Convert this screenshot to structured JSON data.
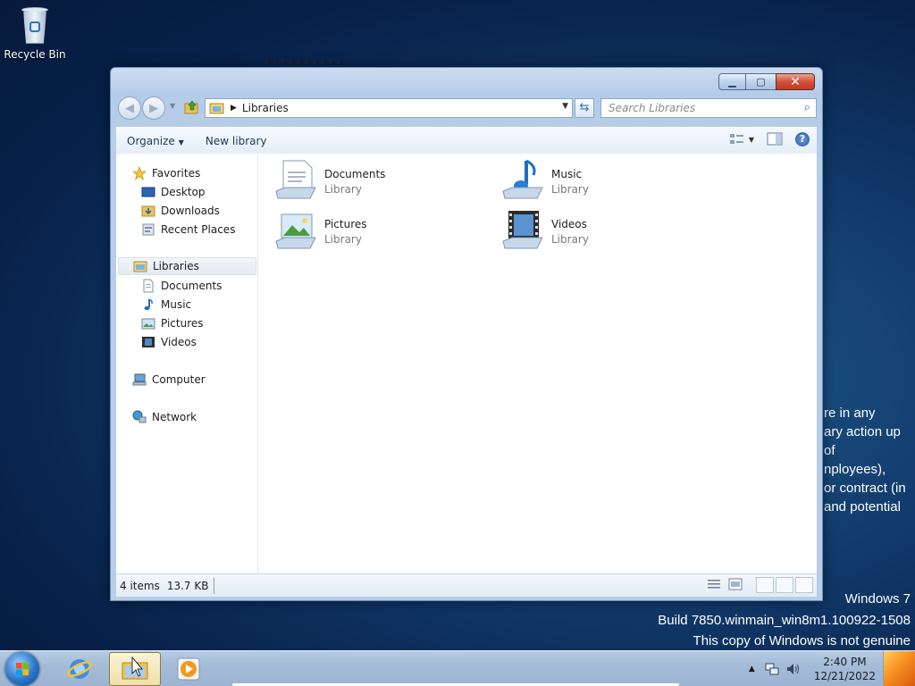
{
  "desktop": {
    "icons": [
      {
        "label": "Recycle Bin",
        "icon": "recycle-bin-icon"
      }
    ],
    "watermark": {
      "line1": "Windows 7",
      "line2": "Build 7850.winmain_win8m1.100922-1508",
      "line3": "This copy of Windows is not genuine"
    },
    "eula_fragment": [
      "re in any",
      "ary action up",
      "of",
      "nployees),",
      " or contract (in",
      "and potential"
    ]
  },
  "window": {
    "controls": {
      "minimize": "▁",
      "maximize": "▢",
      "close": "✕"
    },
    "address": {
      "crumbs": [
        "Libraries"
      ]
    },
    "search": {
      "placeholder": "Search Libraries"
    },
    "toolbar": {
      "organize": "Organize",
      "new_library": "New library"
    },
    "nav": {
      "favorites": {
        "label": "Favorites",
        "items": [
          "Desktop",
          "Downloads",
          "Recent Places"
        ]
      },
      "libraries": {
        "label": "Libraries",
        "items": [
          "Documents",
          "Music",
          "Pictures",
          "Videos"
        ]
      },
      "computer": "Computer",
      "network": "Network"
    },
    "libraries": [
      {
        "name": "Documents",
        "type": "Library",
        "icon": "documents-library-icon"
      },
      {
        "name": "Music",
        "type": "Library",
        "icon": "music-library-icon"
      },
      {
        "name": "Pictures",
        "type": "Library",
        "icon": "pictures-library-icon"
      },
      {
        "name": "Videos",
        "type": "Library",
        "icon": "videos-library-icon"
      }
    ],
    "status": {
      "count": "4 items",
      "size": "13.7 KB"
    }
  },
  "taskbar": {
    "pinned": [
      "internet-explorer-icon",
      "windows-explorer-icon",
      "media-player-icon"
    ],
    "clock": {
      "time": "2:40 PM",
      "date": "12/21/2022"
    }
  },
  "colors": {
    "accent": "#2f6fb3",
    "close": "#c23a22",
    "taskbar": "#a5bcd8"
  }
}
